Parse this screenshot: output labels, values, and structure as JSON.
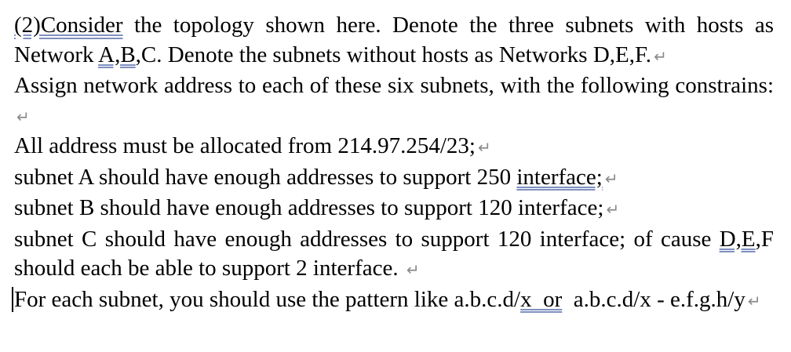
{
  "document": {
    "p1": {
      "prefix": "(2)Consider",
      "t1": " the topology shown here. Denote the three subnets with hosts as Network ",
      "u1": "A,B",
      "t2": ",C. Denote the subnets without hosts as Networks D,E,F.",
      "mark": "↵"
    },
    "p2": {
      "text": "Assign network address to each of these six subnets, with the following constrains: ",
      "mark": "↵"
    },
    "p3": {
      "text": "All address must be allocated from 214.97.254/23;",
      "mark": "↵"
    },
    "p4": {
      "t1": "subnet A should have enough addresses to support 250 ",
      "u1": "interface;",
      "mark": "↵"
    },
    "p5": {
      "text": "subnet B should have enough addresses to support 120 interface;",
      "mark": "↵"
    },
    "p6": {
      "t1": "subnet C should have enough addresses to support 120 interface; of cause ",
      "u1": "D,E",
      "t2": ",F should each be able to support 2 interface. ",
      "mark": "↵"
    },
    "p7": {
      "t1": "For each subnet, you should use the pattern like a.b.c.d/",
      "u1": "x  or",
      "t2": "  a.b.c.d/x - e.f.g.h/y",
      "mark": "↵"
    }
  },
  "colors": {
    "text": "#000000",
    "paragraph_mark": "#8a8a8a",
    "underline": "#7f8fbf"
  }
}
